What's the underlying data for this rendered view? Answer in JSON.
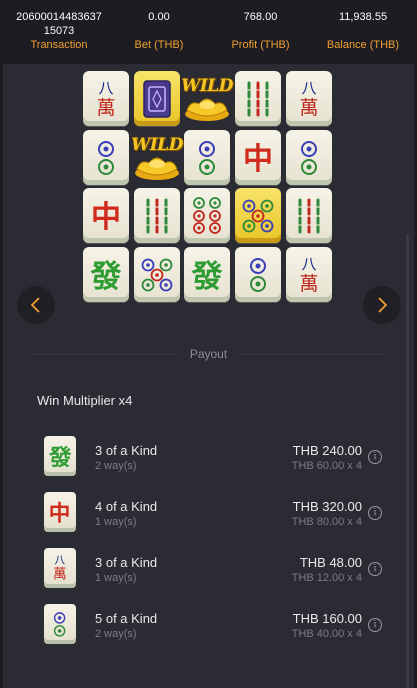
{
  "header": {
    "transaction_value": "20600014483637 15073",
    "transaction_label": "Transaction",
    "bet_value": "0.00",
    "bet_label": "Bet (THB)",
    "profit_value": "768.00",
    "profit_label": "Profit (THB)",
    "balance_value": "11,938.55",
    "balance_label": "Balance (THB)"
  },
  "board": {
    "grid": [
      [
        "wan8",
        "frame",
        "wild",
        "bamboo6",
        "wan8"
      ],
      [
        "circle2",
        "wild",
        "circle2",
        "zhong",
        "circle2"
      ],
      [
        "zhong",
        "bamboo6",
        "circle6",
        "circle5-gold",
        "bamboo6"
      ],
      [
        "fa",
        "circle5",
        "fa",
        "circle2",
        "wan8"
      ]
    ],
    "wild_text": "WILD"
  },
  "nav": {
    "prev_icon": "chevron-left-icon",
    "next_icon": "chevron-right-icon"
  },
  "payout": {
    "title": "Payout",
    "win_multiplier": "Win Multiplier x4",
    "rows": [
      {
        "symbol": "fa",
        "kind": "3 of a Kind",
        "ways": "2 way(s)",
        "amount": "THB 240.00",
        "calc": "THB 60.00 x 4"
      },
      {
        "symbol": "zhong",
        "kind": "4 of a Kind",
        "ways": "1 way(s)",
        "amount": "THB 320.00",
        "calc": "THB 80.00 x 4"
      },
      {
        "symbol": "wan8",
        "kind": "3 of a Kind",
        "ways": "1 way(s)",
        "amount": "THB 48.00",
        "calc": "THB 12.00 x 4"
      },
      {
        "symbol": "circle2",
        "kind": "5 of a Kind",
        "ways": "2 way(s)",
        "amount": "THB 160.00",
        "calc": "THB 40.00 x 4"
      }
    ],
    "info_glyph": "i"
  },
  "colors": {
    "accent": "#f0a030",
    "panel": "#2b2b33",
    "background": "#1c1c22"
  }
}
